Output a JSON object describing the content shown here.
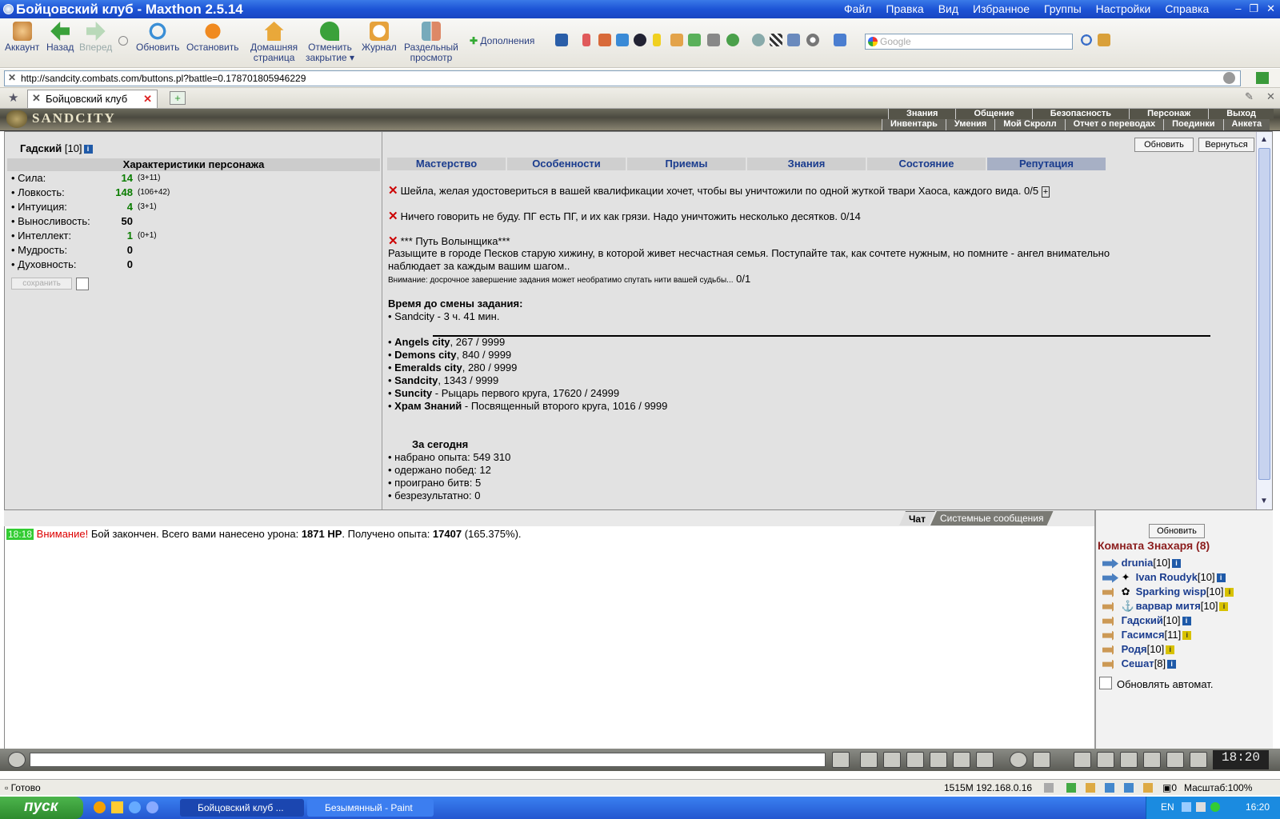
{
  "window": {
    "title": "Бойцовский клуб - Maxthon 2.5.14"
  },
  "menu": [
    "Файл",
    "Правка",
    "Вид",
    "Избранное",
    "Группы",
    "Настройки",
    "Справка"
  ],
  "toolbar": {
    "account": "Аккаунт",
    "back": "Назад",
    "forward": "Вперед",
    "refresh": "Обновить",
    "stop": "Остановить",
    "home": [
      "Домашняя",
      "страница"
    ],
    "undo_close": [
      "Отменить",
      "закрытие"
    ],
    "journal": "Журнал",
    "split": [
      "Раздельный",
      "просмотр"
    ],
    "addons": "Дополнения",
    "search_placeholder": "Google"
  },
  "address": {
    "url": "http://sandcity.combats.com/buttons.pl?battle=0.178701805946229"
  },
  "tab": {
    "label": "Бойцовский клуб"
  },
  "game": {
    "logo": "SANDCITY",
    "nav_top": [
      "Знания",
      "Общение",
      "Безопасность",
      "Персонаж",
      "Выход"
    ],
    "nav_bottom": [
      "Инвентарь",
      "Умения",
      "Мой Скролл",
      "Отчет о переводах",
      "Поединки",
      "Анкета"
    ],
    "player": {
      "name": "Гадский",
      "level": "[10]"
    },
    "char_header": "Характеристики персонажа",
    "stats": [
      {
        "label": "• Сила:",
        "value": "14",
        "extra": "(3+11)"
      },
      {
        "label": "• Ловкость:",
        "value": "148",
        "extra": "(106+42)"
      },
      {
        "label": "• Интуиция:",
        "value": "4",
        "extra": "(3+1)"
      },
      {
        "label": "• Выносливость:",
        "value": "50",
        "extra": ""
      },
      {
        "label": "• Интеллект:",
        "value": "1",
        "extra": "(0+1)"
      },
      {
        "label": "• Мудрость:",
        "value": "0",
        "extra": ""
      },
      {
        "label": "• Духовность:",
        "value": "0",
        "extra": ""
      }
    ],
    "save_label": "сохранить",
    "refresh_btn": "Обновить",
    "return_btn": "Вернуться",
    "tabs": [
      "Мастерство",
      "Особенности",
      "Приемы",
      "Знания",
      "Состояние",
      "Репутация"
    ],
    "quests": [
      "Шейла, желая удостовериться в вашей квалификации хочет, чтобы вы уничтожили по одной жуткой твари Хаоса, каждого вида. 0/5",
      "Ничего говорить не буду. ПГ есть ПГ, и их как грязи. Надо уничтожить несколько десятков. 0/14",
      "*** Путь Волынщика***"
    ],
    "quest3_text1": "Разыщите в городе Песков старую хижину, в которой живет несчастная семья. Поступайте так, как сочтете нужным, но помните - ангел внимательно",
    "quest3_text2": "наблюдает за каждым вашим шагом..",
    "quest3_warn": "Внимание: досрочное завершение задания может необратимо спутать нити вашей судьбы...",
    "quest3_count": "0/1",
    "time_header": "Время до смены задания:",
    "time_line": "• Sandcity - 3 ч. 41 мин.",
    "reputation": [
      {
        "city": "Angels city",
        "rest": ", 267 / 9999"
      },
      {
        "city": "Demons city",
        "rest": ", 840 / 9999"
      },
      {
        "city": "Emeralds city",
        "rest": ", 280 / 9999"
      },
      {
        "city": "Sandcity",
        "rest": ", 1343 / 9999"
      },
      {
        "city": "Suncity",
        "rest": " - Рыцарь первого круга, 17620 / 24999"
      },
      {
        "city": "Храм Знаний",
        "rest": " - Посвященный второго круга, 1016 / 9999"
      }
    ],
    "today_header": "За сегодня",
    "today": [
      "• набрано опыта: 549 310",
      "• одержано побед: 12",
      "• проиграно битв: 5",
      "• безрезультатно: 0"
    ]
  },
  "chat": {
    "tabs": [
      "Чат",
      "Системные сообщения"
    ],
    "time": "18:18",
    "warn": "Внимание!",
    "msg1": " Бой закончен. Всего вами нанесено урона: ",
    "dmg": "1871 HP",
    "msg2": ". Получено опыта: ",
    "exp": "17407",
    "msg3": " (165.375%)."
  },
  "room": {
    "refresh": "Обновить",
    "title": "Комната Знахаря (8)",
    "users": [
      {
        "name": "drunia",
        "lvl": "[10]"
      },
      {
        "name": "Ivan Roudyk",
        "lvl": "[10]"
      },
      {
        "name": "Sparking wisp",
        "lvl": "[10]"
      },
      {
        "name": "варвар митя",
        "lvl": "[10]"
      },
      {
        "name": "Гадский",
        "lvl": "[10]"
      },
      {
        "name": "Гасимся",
        "lvl": "[11]"
      },
      {
        "name": "Родя",
        "lvl": "[10]"
      },
      {
        "name": "Сешат",
        "lvl": "[8]"
      }
    ],
    "auto": "Обновлять автомат."
  },
  "clock": "18:20",
  "status": {
    "ready": "Готово",
    "mem": "1515M 192.168.0.16",
    "zoom": "Масштаб:100%"
  },
  "taskbar": {
    "start": "пуск",
    "task1": "Бойцовский клуб ...",
    "task2": "Безымянный - Paint",
    "lang": "EN",
    "time": "16:20"
  }
}
